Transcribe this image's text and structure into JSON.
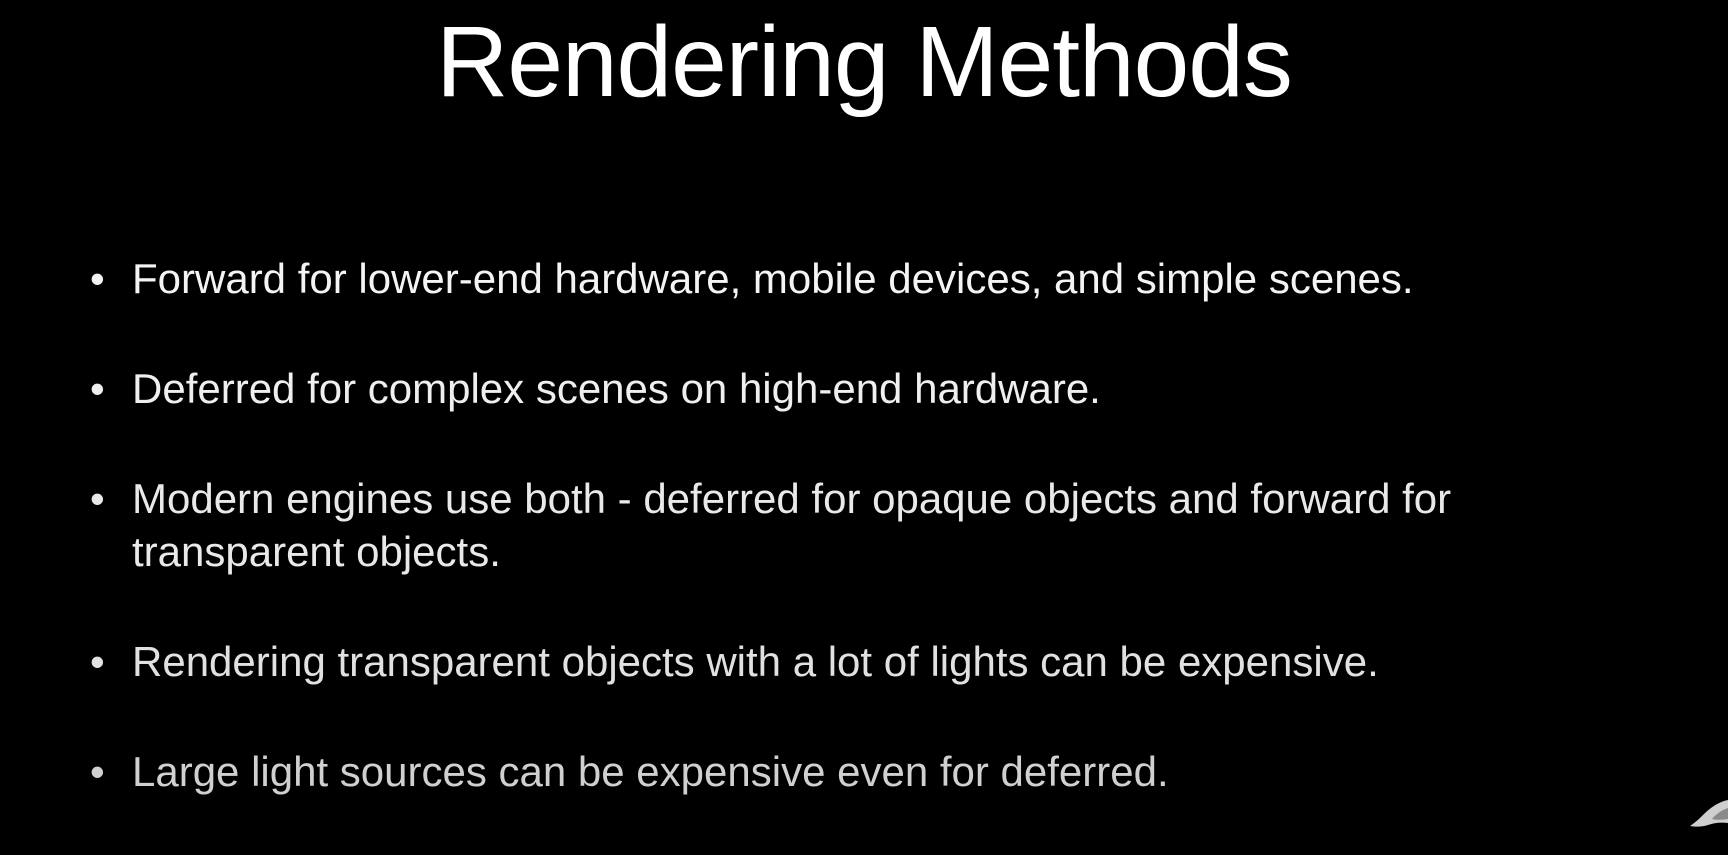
{
  "slide": {
    "title": "Rendering Methods",
    "bullet_glyph": "•",
    "bullets": [
      {
        "text": "Forward for lower-end hardware, mobile devices, and simple scenes."
      },
      {
        "text": "Deferred for complex scenes on high-end hardware."
      },
      {
        "text": "Modern engines use both - deferred for opaque objects and forward for transparent objects."
      },
      {
        "text": "Rendering transparent objects with a lot of lights can be expensive."
      },
      {
        "text": "Large light sources can be expensive even for deferred."
      }
    ]
  },
  "colors": {
    "background": "#000000",
    "title": "#ffffff",
    "text": "#f2f2f2"
  }
}
